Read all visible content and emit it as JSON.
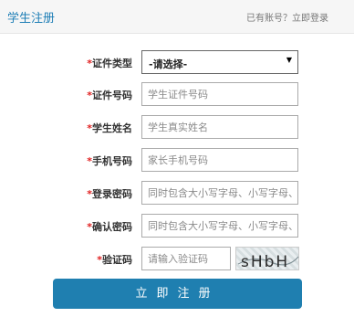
{
  "header": {
    "title": "学生注册",
    "login_link": "已有账号？立即登录"
  },
  "form": {
    "required_mark": "*",
    "id_type": {
      "label": "证件类型",
      "value": "-请选择-"
    },
    "id_number": {
      "label": "证件号码",
      "placeholder": "学生证件号码"
    },
    "student_name": {
      "label": "学生姓名",
      "placeholder": "学生真实姓名"
    },
    "phone": {
      "label": "手机号码",
      "placeholder": "家长手机号码"
    },
    "password": {
      "label": "登录密码",
      "placeholder": "同时包含大小写字母、小写字母、数字"
    },
    "confirm_password": {
      "label": "确认密码",
      "placeholder": "同时包含大小写字母、小写字母、数字"
    },
    "captcha": {
      "label": "验证码",
      "placeholder": "请输入验证码",
      "image_text": "sHbH"
    }
  },
  "submit_label": "立即注册",
  "colors": {
    "accent": "#1f7fb0",
    "required": "#e02020",
    "header_bg": "#f6f6f6"
  }
}
